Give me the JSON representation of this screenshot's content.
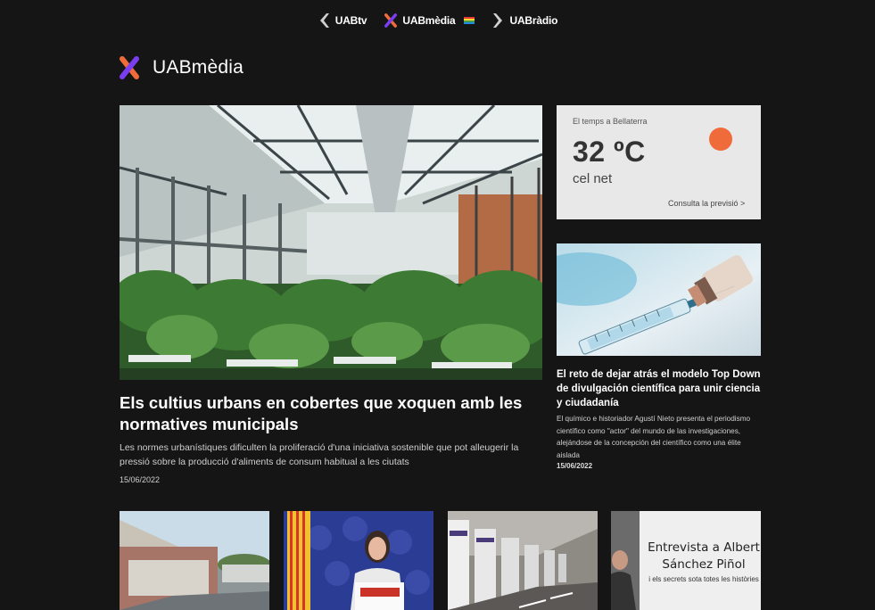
{
  "network": {
    "items": [
      {
        "label": "UABtv",
        "icon": "chevron-left-icon"
      },
      {
        "label": "UABmèdia",
        "icon": "uabmedia-logo-icon"
      },
      {
        "label": "UABràdio",
        "icon": "chevron-right-icon"
      }
    ]
  },
  "brand": {
    "name": "UABmèdia"
  },
  "hero": {
    "title": "Els cultius urbans en cobertes que xoquen amb les normatives municipals",
    "description": "Les normes urbanístiques dificulten la proliferació d'una iniciativa sostenible que pot alleugerir la pressió sobre la producció d'aliments de consum habitual a les ciutats",
    "date": "15/06/2022"
  },
  "weather": {
    "label": "El temps a Bellaterra",
    "temperature": "32 ºC",
    "condition": "cel net",
    "link": "Consulta la previsió >",
    "sun_color": "#ef6b3a"
  },
  "side_article": {
    "title": "El reto de dejar atrás el modelo Top Down de divulgación científica para unir ciencia y ciudadanía",
    "description": "El químico e historiador Agustí Nieto presenta el periodismo científico como \"actor\" del mundo de las investigaciones, alejándose de la concepción del científico como una élite aislada",
    "date": "15/06/2022"
  },
  "bottom_row": {
    "interview": {
      "title": "Entrevista a Albert Sánchez Piñol",
      "subtitle": "i els secrets sota totes les històries"
    }
  },
  "colors": {
    "background": "#151515",
    "accent_orange": "#ef6b3a",
    "accent_purple": "#7a3df0"
  }
}
